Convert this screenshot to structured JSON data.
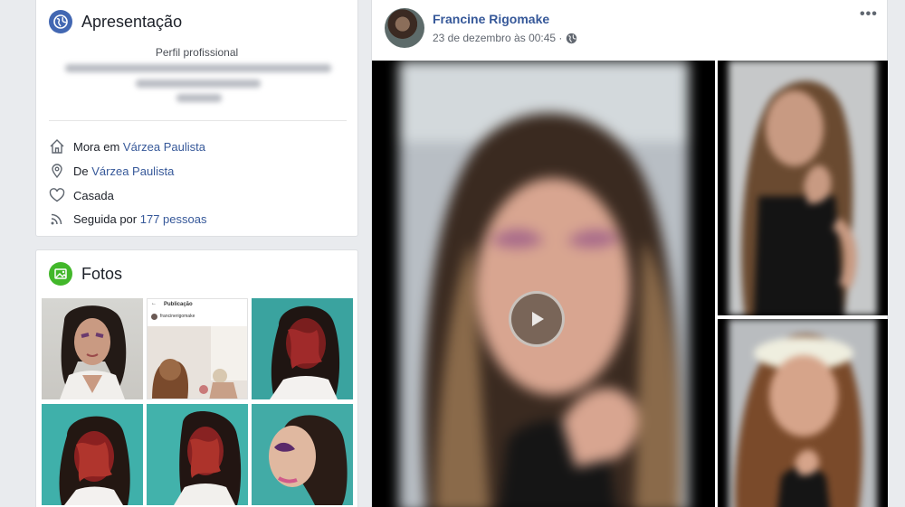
{
  "intro": {
    "title": "Apresentação",
    "profile_label": "Perfil profissional",
    "lives_prefix": "Mora em",
    "lives_city": "Várzea Paulista",
    "from_prefix": "De",
    "from_city": "Várzea Paulista",
    "relationship": "Casada",
    "followed_prefix": "Seguida por",
    "followers": "177 pessoas",
    "icons": [
      "globe-icon",
      "home-icon",
      "location-pin-icon",
      "heart-icon",
      "rss-feed-icon"
    ]
  },
  "photos": {
    "title": "Fotos",
    "thumb2_header": "Publicação",
    "thumb2_user": "francinerigomake"
  },
  "post": {
    "author": "Francine Rigomake",
    "timestamp": "23 de dezembro às 00:45 ·",
    "more": "•••"
  },
  "colors": {
    "link": "#365899",
    "page_bg": "#e9ebee",
    "globe_badge": "#4267b2",
    "photo_badge": "#42b72a"
  }
}
